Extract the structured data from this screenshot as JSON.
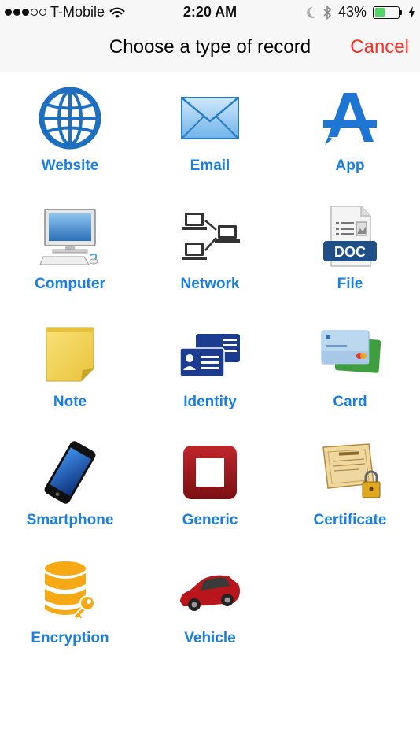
{
  "status_bar": {
    "carrier": "T-Mobile",
    "time": "2:20 AM",
    "battery_percent": "43%",
    "battery_level": 0.43,
    "signal_bars_filled": 3,
    "signal_bars_total": 5
  },
  "nav": {
    "title": "Choose a type of record",
    "cancel_label": "Cancel"
  },
  "colors": {
    "label_blue": "#1a7fe0",
    "cancel_red": "#ff2d21",
    "battery_green": "#4cd964"
  },
  "record_types": [
    {
      "label": "Website",
      "icon": "globe-icon"
    },
    {
      "label": "Email",
      "icon": "envelope-icon"
    },
    {
      "label": "App",
      "icon": "app-store-icon"
    },
    {
      "label": "Computer",
      "icon": "desktop-computer-icon"
    },
    {
      "label": "Network",
      "icon": "network-icon"
    },
    {
      "label": "File",
      "icon": "doc-file-icon"
    },
    {
      "label": "Note",
      "icon": "sticky-note-icon"
    },
    {
      "label": "Identity",
      "icon": "id-card-icon"
    },
    {
      "label": "Card",
      "icon": "credit-card-icon"
    },
    {
      "label": "Smartphone",
      "icon": "smartphone-icon"
    },
    {
      "label": "Generic",
      "icon": "generic-square-icon"
    },
    {
      "label": "Certificate",
      "icon": "certificate-lock-icon"
    },
    {
      "label": "Encryption",
      "icon": "database-key-icon"
    },
    {
      "label": "Vehicle",
      "icon": "car-icon"
    }
  ]
}
